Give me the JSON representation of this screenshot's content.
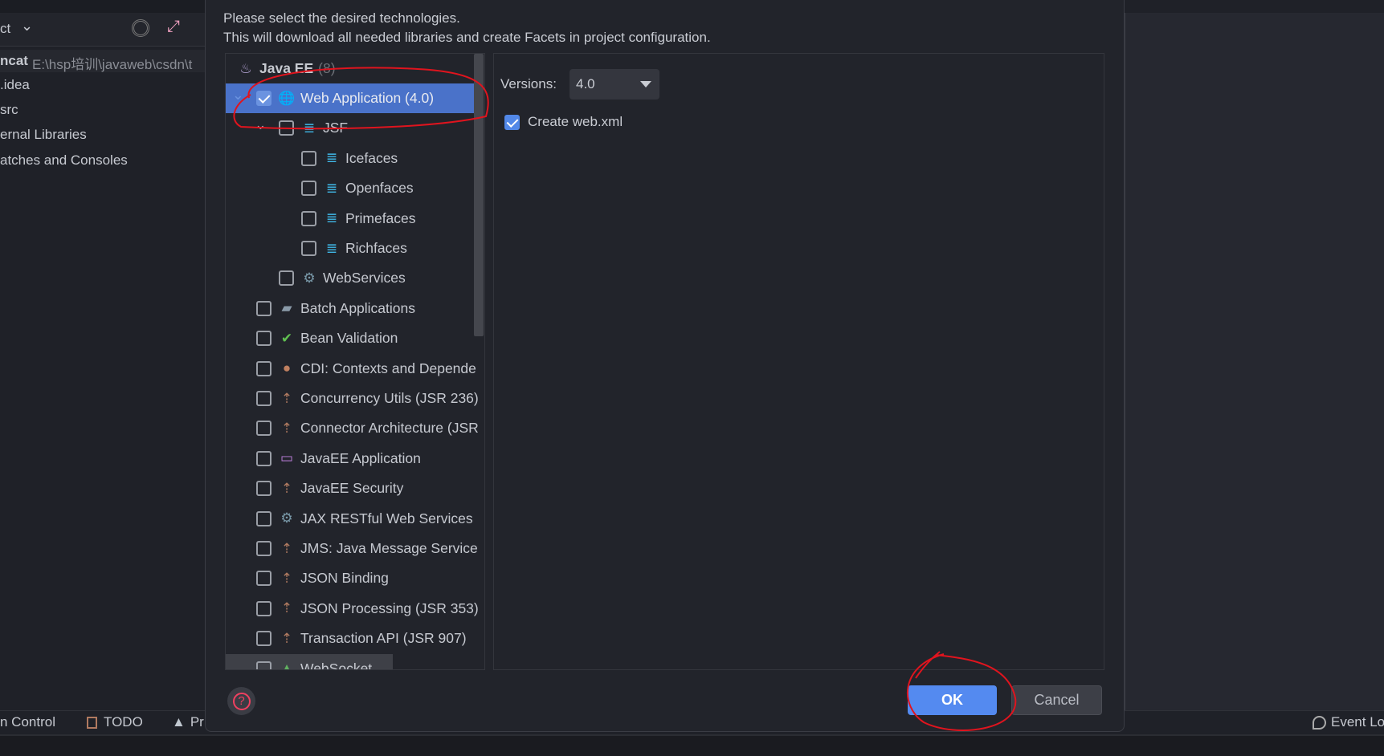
{
  "sidebar": {
    "title_fragment": "ct",
    "project_name": "ncat",
    "project_path": "E:\\hsp培训\\javaweb\\csdn\\t",
    "items": [
      ".idea",
      "src",
      "ernal Libraries",
      "atches and Consoles"
    ]
  },
  "dialog": {
    "line1": "Please select the desired technologies.",
    "line2": "This will download all needed libraries and create Facets in project configuration.",
    "group": {
      "label": "Java EE",
      "count": "(8)"
    },
    "tree": [
      {
        "label": "Web Application (4.0)",
        "checked": true,
        "selected": true,
        "level": 1,
        "icon": "globe-icon",
        "expander": true
      },
      {
        "label": "JSF",
        "checked": false,
        "level": 2,
        "icon": "jsf-icon",
        "expander": true
      },
      {
        "label": "Icefaces",
        "checked": false,
        "level": 3,
        "icon": "jsf-icon"
      },
      {
        "label": "Openfaces",
        "checked": false,
        "level": 3,
        "icon": "jsf-icon"
      },
      {
        "label": "Primefaces",
        "checked": false,
        "level": 3,
        "icon": "jsf-icon"
      },
      {
        "label": "Richfaces",
        "checked": false,
        "level": 3,
        "icon": "jsf-icon"
      },
      {
        "label": "WebServices",
        "checked": false,
        "level": 2,
        "icon": "gear-icon"
      },
      {
        "label": "Batch Applications",
        "checked": false,
        "level": 1,
        "icon": "folder-icon"
      },
      {
        "label": "Bean Validation",
        "checked": false,
        "level": 1,
        "icon": "bean-validation-icon"
      },
      {
        "label": "CDI: Contexts and Depende",
        "checked": false,
        "level": 1,
        "icon": "beans-icon"
      },
      {
        "label": "Concurrency Utils (JSR 236)",
        "checked": false,
        "level": 1,
        "icon": "module-icon"
      },
      {
        "label": "Connector Architecture (JSR",
        "checked": false,
        "level": 1,
        "icon": "module-icon"
      },
      {
        "label": "JavaEE Application",
        "checked": false,
        "level": 1,
        "icon": "folder-purple-icon"
      },
      {
        "label": "JavaEE Security",
        "checked": false,
        "level": 1,
        "icon": "module-icon"
      },
      {
        "label": "JAX RESTful Web Services",
        "checked": false,
        "level": 1,
        "icon": "gear-icon"
      },
      {
        "label": "JMS: Java Message Service",
        "checked": false,
        "level": 1,
        "icon": "module-icon"
      },
      {
        "label": "JSON Binding",
        "checked": false,
        "level": 1,
        "icon": "module-icon"
      },
      {
        "label": "JSON Processing (JSR 353)",
        "checked": false,
        "level": 1,
        "icon": "module-icon"
      },
      {
        "label": "Transaction API (JSR 907)",
        "checked": false,
        "level": 1,
        "icon": "module-icon"
      },
      {
        "label": "WebSocket",
        "checked": false,
        "level": 1,
        "icon": "plugin-icon"
      }
    ],
    "versions_label": "Versions:",
    "version_value": "4.0",
    "create_webxml_label": "Create web.xml",
    "create_webxml_checked": true,
    "ok_label": "OK",
    "cancel_label": "Cancel"
  },
  "statusbar": {
    "items": [
      "n Control",
      "TODO",
      "Pr"
    ],
    "event_log": "Event Lo"
  },
  "colors": {
    "accent": "#548af0",
    "selection": "#4a72c9",
    "annotation": "#e0141e"
  }
}
